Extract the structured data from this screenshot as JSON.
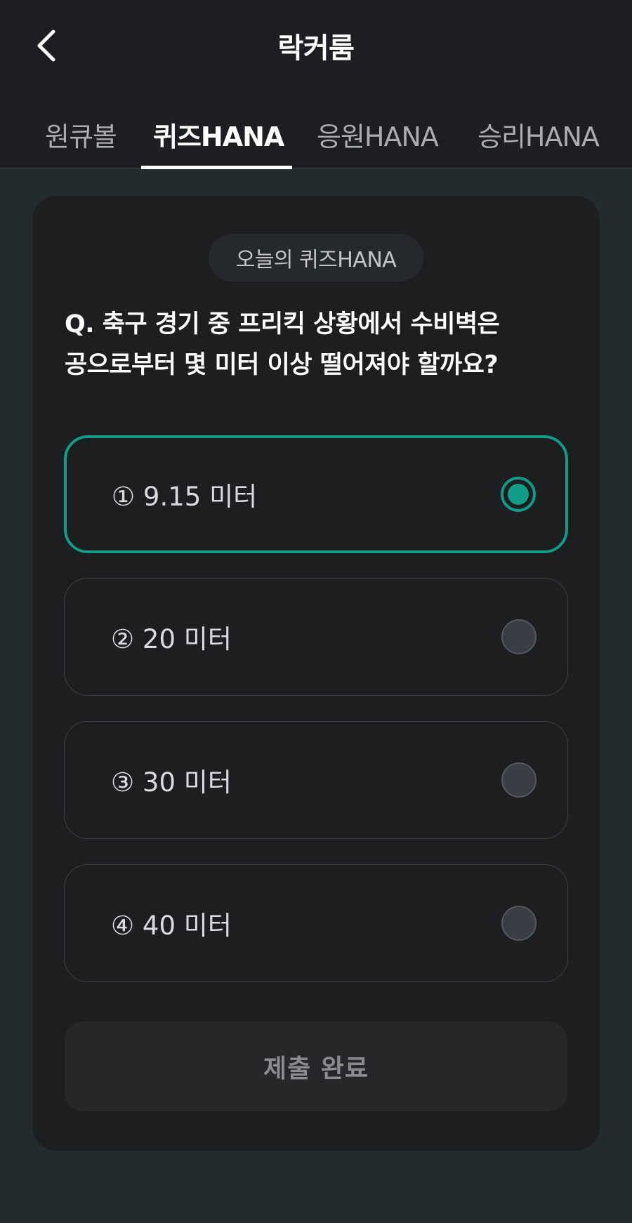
{
  "header": {
    "title": "락커룸",
    "back_icon": "chevron-left-icon"
  },
  "tabs": [
    {
      "label": "원큐볼",
      "active": false
    },
    {
      "label": "퀴즈HANA",
      "active": true
    },
    {
      "label": "응원HANA",
      "active": false
    },
    {
      "label": "승리HANA",
      "active": false
    }
  ],
  "quiz": {
    "badge": "오늘의 퀴즈HANA",
    "question_line1": "Q. 축구 경기 중 프리킥 상황에서 수비벽은",
    "question_line2": "공으로부터 몇 미터 이상 떨어져야 할까요?",
    "options": [
      {
        "label": "① 9.15 미터",
        "selected": true
      },
      {
        "label": "② 20 미터",
        "selected": false
      },
      {
        "label": "③ 30 미터",
        "selected": false
      },
      {
        "label": "④ 40 미터",
        "selected": false
      }
    ],
    "submit_label": "제출 완료"
  },
  "colors": {
    "accent": "#119c85",
    "background": "#232b2d",
    "card": "#1d1e20",
    "header": "#1c1e21"
  }
}
